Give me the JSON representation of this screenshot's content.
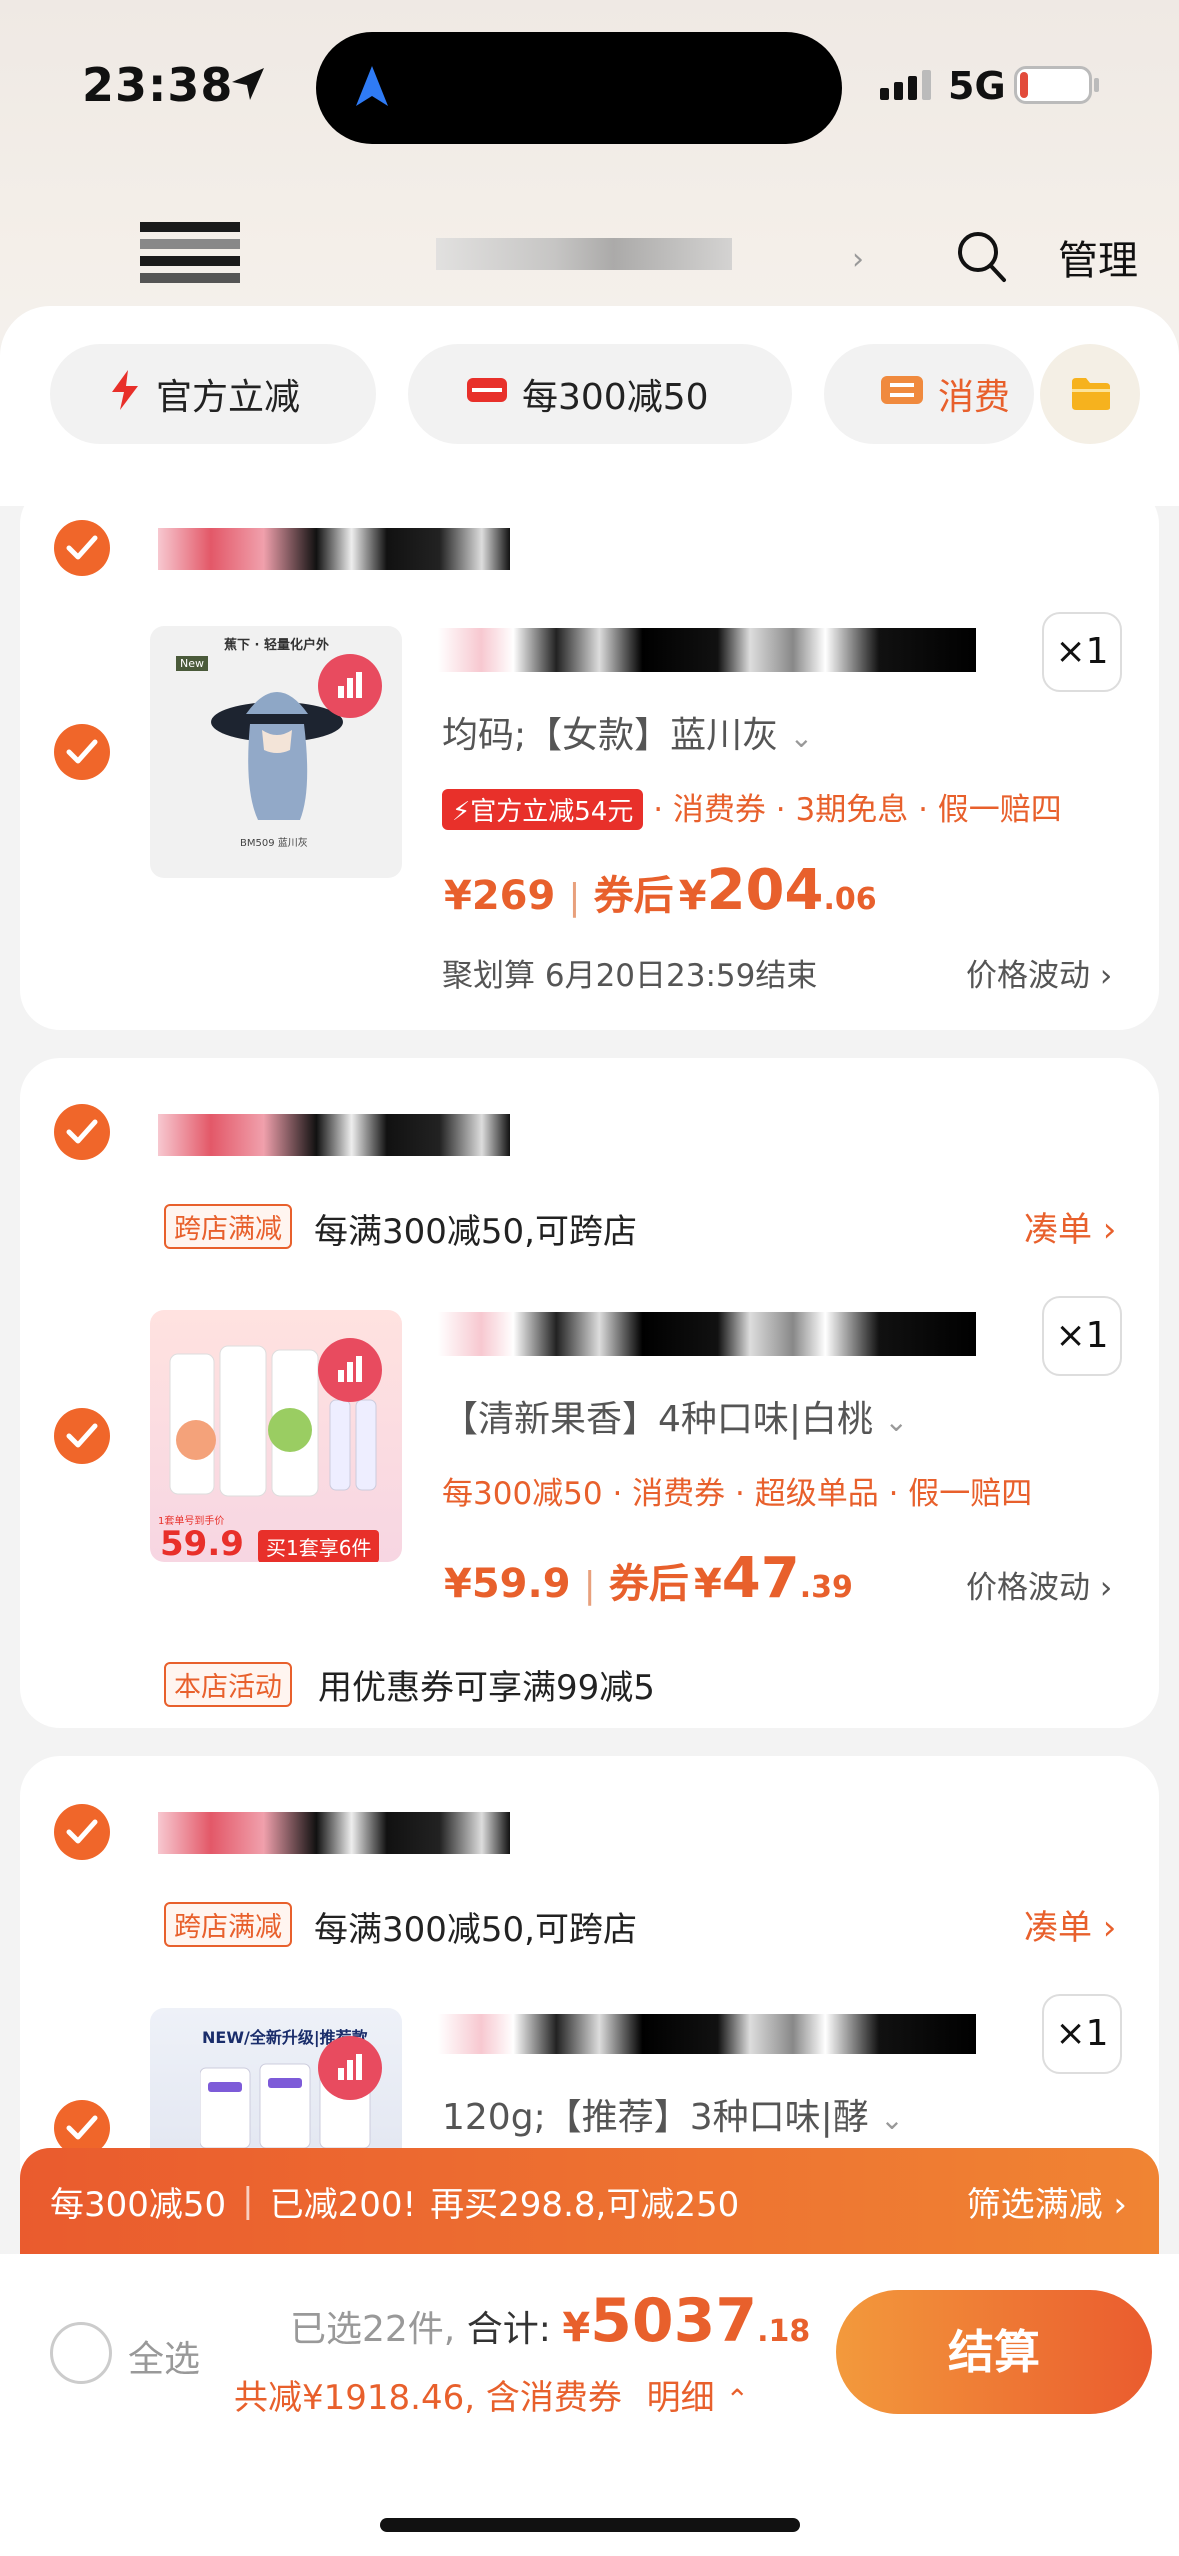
{
  "status_bar": {
    "time": "23:38",
    "network": "5G",
    "battery": "11",
    "battery_level": 0.11
  },
  "header": {
    "manage_label": "管理"
  },
  "filter_chips": [
    {
      "label": "官方立减",
      "icon": "flash-icon"
    },
    {
      "label": "每300减50",
      "icon": "coupon-icon"
    },
    {
      "label": "消费",
      "icon": "voucher-icon"
    },
    {
      "label": "",
      "icon": "folder-icon"
    }
  ],
  "items": [
    {
      "quantity": "×1",
      "thumb_caption_top": "蕉下 · 轻量化户外",
      "thumb_badge": "New",
      "thumb_caption_bottom": "BM509 蓝川灰",
      "spec": "均码;【女款】蓝川灰",
      "flash_tag": "官方立减54元",
      "tags": "· 消费券 · 3期免息 · 假一赔四",
      "price": "¥269",
      "after_label": "券后",
      "after_currency": "¥",
      "after_int": "204",
      "after_dec": ".06",
      "note": "聚划算 6月20日23:59结束",
      "trend": "价格波动"
    },
    {
      "promo_tag": "跨店满减",
      "promo_text": "每满300减50,可跨店",
      "promo_link": "凑单",
      "quantity": "×1",
      "thumb_price_prefix": "1套单号到手价",
      "thumb_price": "59.9",
      "thumb_cta": "买1套享6件",
      "spec": "【清新果香】4种口味|白桃",
      "tags": "每300减50 · 消费券 · 超级单品 · 假一赔四",
      "price": "¥59.9",
      "after_label": "券后",
      "after_currency": "¥",
      "after_int": "47",
      "after_dec": ".39",
      "trend": "价格波动",
      "shop_tag": "本店活动",
      "shop_text": "用优惠券可享满99减5"
    },
    {
      "promo_tag": "跨店满减",
      "promo_text": "每满300减50,可跨店",
      "promo_link": "凑单",
      "quantity": "×1",
      "thumb_caption": "NEW/全新升级|推荐款",
      "spec": "120g;【推荐】3种口味|酵"
    }
  ],
  "promo_bar": {
    "part1": "每300减50",
    "part2": "已减200!",
    "part3": "再买298.8,可减250",
    "right": "筛选满减"
  },
  "footer": {
    "select_all": "全选",
    "selected": "已选22件,",
    "total_label": "合计:",
    "total_currency": "¥",
    "total_int": "5037",
    "total_dec": ".18",
    "saved": "共减¥1918.46, 含消费券",
    "detail": "明细",
    "checkout": "结算"
  },
  "colors": {
    "accent": "#e8602c",
    "brand_gradient_start": "#ea5b2e",
    "brand_gradient_end": "#f08433",
    "check": "#f0662a"
  }
}
